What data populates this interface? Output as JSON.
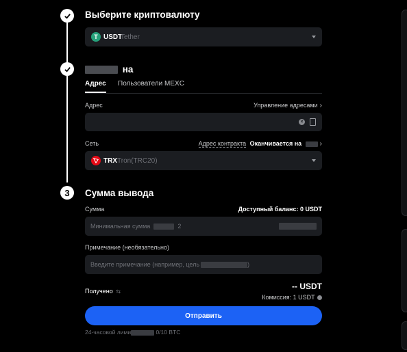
{
  "steps": {
    "one_title": "Выберите криптовалюту",
    "two_title": "на",
    "three_number": "3",
    "three_title": "Сумма вывода"
  },
  "crypto": {
    "symbol": "USDT",
    "name": "Tether",
    "icon_letter": "T",
    "icon_color": "#26a17b"
  },
  "tabs": {
    "address": "Адрес",
    "mexc_users": "Пользователи MEXC"
  },
  "address": {
    "label": "Адрес",
    "manage_label": "Управление адресами"
  },
  "network": {
    "label": "Сеть",
    "contract_label": "Адрес контракта",
    "ends_with_label": "Оканчивается на",
    "symbol": "TRX",
    "name": "Tron(TRC20)",
    "icon_color": "#e50915"
  },
  "amount": {
    "label": "Сумма",
    "balance_label": "Доступный баланс: 0 USDT",
    "placeholder_prefix": "Минимальная сумма",
    "placeholder_value": "2"
  },
  "note": {
    "label": "Примечание (необязательно)",
    "placeholder_prefix": "Введите примечание (например, цель",
    "placeholder_suffix": ")"
  },
  "received": {
    "label": "Получено",
    "value": "-- USDT",
    "fee_label": "Комиссия: 1 USDT"
  },
  "submit_label": "Отправить",
  "limit": {
    "prefix": "24-часовой лими",
    "value": "0/10 BTC"
  },
  "colors": {
    "accent": "#1c62f5",
    "field_bg": "#1b1d21",
    "tab_underline": "#ffffff"
  }
}
